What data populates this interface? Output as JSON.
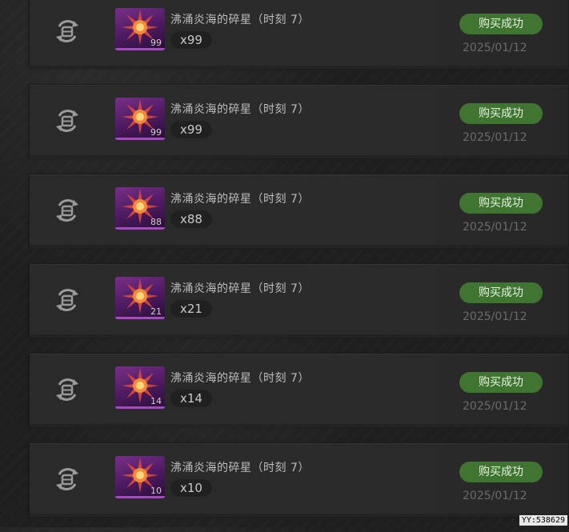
{
  "orders": [
    {
      "item_name": "沸涌炎海的碎星（时刻 7）",
      "icon_count": "99",
      "quantity": "x99",
      "status": "购买成功",
      "date": "2025/01/12"
    },
    {
      "item_name": "沸涌炎海的碎星（时刻 7）",
      "icon_count": "99",
      "quantity": "x99",
      "status": "购买成功",
      "date": "2025/01/12"
    },
    {
      "item_name": "沸涌炎海的碎星（时刻 7）",
      "icon_count": "88",
      "quantity": "x88",
      "status": "购买成功",
      "date": "2025/01/12"
    },
    {
      "item_name": "沸涌炎海的碎星（时刻 7）",
      "icon_count": "21",
      "quantity": "x21",
      "status": "购买成功",
      "date": "2025/01/12"
    },
    {
      "item_name": "沸涌炎海的碎星（时刻 7）",
      "icon_count": "14",
      "quantity": "x14",
      "status": "购买成功",
      "date": "2025/01/12"
    },
    {
      "item_name": "沸涌炎海的碎星（时刻 7）",
      "icon_count": "10",
      "quantity": "x10",
      "status": "购买成功",
      "date": "2025/01/12"
    }
  ],
  "watermark": "YY:538629",
  "icons": {
    "row_action": "refresh-cycle-icon",
    "item": "shattered-star-icon"
  },
  "colors": {
    "status_bg": "#3f7531",
    "rarity_purple": "#7a2f8a",
    "date_gray": "#6b6b6b"
  }
}
